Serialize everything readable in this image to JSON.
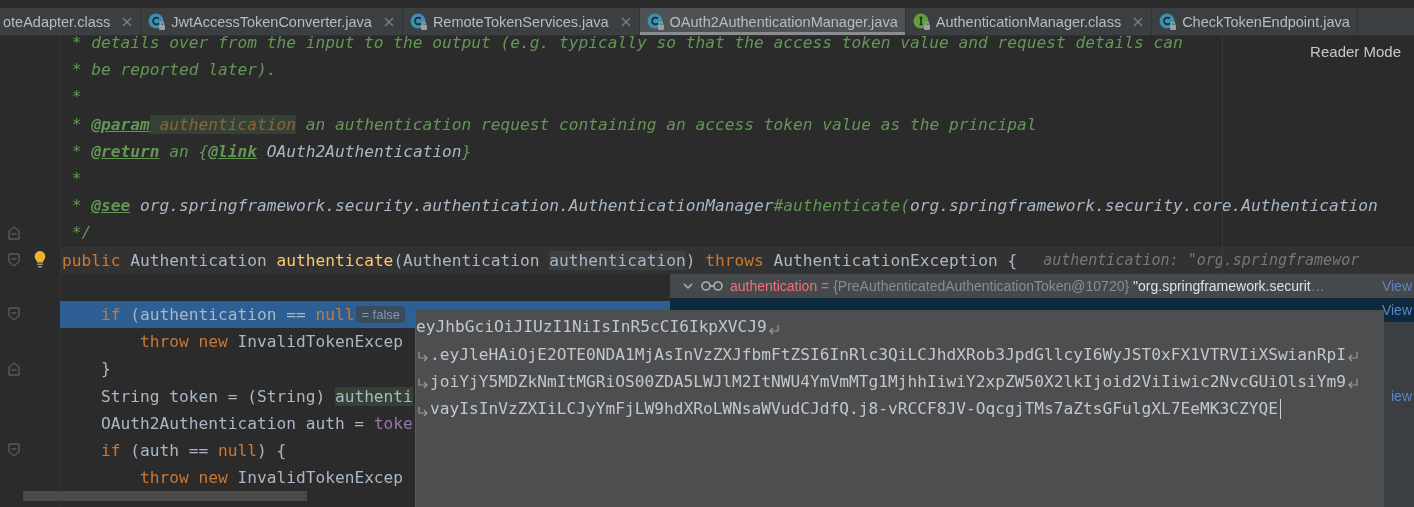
{
  "tabs": [
    {
      "label": "oteAdapter.class",
      "selected": false,
      "closable": true
    },
    {
      "label": "JwtAccessTokenConverter.java",
      "kind": "class",
      "selected": false,
      "closable": true
    },
    {
      "label": "RemoteTokenServices.java",
      "kind": "class",
      "selected": false,
      "closable": true
    },
    {
      "label": "OAuth2AuthenticationManager.java",
      "kind": "class",
      "selected": true,
      "closable": false
    },
    {
      "label": "AuthenticationManager.class",
      "kind": "interface",
      "selected": false,
      "closable": true
    },
    {
      "label": "CheckTokenEndpoint.java",
      "kind": "class",
      "selected": false,
      "closable": false
    }
  ],
  "reader_mode": "Reader Mode",
  "lines": [
    {
      "kind": "plain",
      "segments": [
        {
          "text": " * details over from the input to the output (e.g. typically so that the access token value and request details can",
          "kind": "comment"
        }
      ]
    },
    {
      "kind": "plain",
      "segments": [
        {
          "text": " * be reported later).",
          "kind": "comment"
        }
      ]
    },
    {
      "kind": "plain",
      "segments": [
        {
          "text": " *",
          "kind": "comment"
        }
      ]
    },
    {
      "kind": "plain",
      "segments": [
        {
          "text": " * ",
          "kind": "comment"
        },
        {
          "text": "@param",
          "kind": "doc-tag"
        },
        {
          "text": " authentication",
          "kind": "doc-param"
        },
        {
          "text": " an authentication request containing an access token value as the principal",
          "kind": "comment"
        }
      ]
    },
    {
      "kind": "plain",
      "segments": [
        {
          "text": " * ",
          "kind": "comment"
        },
        {
          "text": "@return",
          "kind": "doc-tag"
        },
        {
          "text": " an {",
          "kind": "comment"
        },
        {
          "text": "@link",
          "kind": "doc-tag"
        },
        {
          "text": " OAuth2Authentication",
          "kind": "doc-ref"
        },
        {
          "text": "}",
          "kind": "comment"
        }
      ]
    },
    {
      "kind": "plain",
      "segments": [
        {
          "text": " *",
          "kind": "comment"
        }
      ]
    },
    {
      "kind": "plain",
      "segments": [
        {
          "text": " * ",
          "kind": "comment"
        },
        {
          "text": "@see",
          "kind": "doc-tag"
        },
        {
          "text": " org.springframework.security.authentication.AuthenticationManager",
          "kind": "doc-ref"
        },
        {
          "text": "#authenticate(",
          "kind": "comment"
        },
        {
          "text": "org.springframework.security.core.Authentication",
          "kind": "doc-ref"
        }
      ]
    },
    {
      "kind": "plain",
      "fold_end": true,
      "segments": [
        {
          "text": " */",
          "kind": "comment"
        }
      ]
    },
    {
      "kind": "caret",
      "fold_start": true,
      "bulb": true,
      "segments": [
        {
          "text": "public",
          "kind": "keyword"
        },
        {
          "text": " Authentication ",
          "kind": "plain"
        },
        {
          "text": "authenticate",
          "kind": "method"
        },
        {
          "text": "(Authentication ",
          "kind": "plain"
        },
        {
          "text": "authentication",
          "kind": "declaration"
        },
        {
          "text": ") ",
          "kind": "plain"
        },
        {
          "text": "throws",
          "kind": "keyword"
        },
        {
          "text": " AuthenticationException {",
          "kind": "plain"
        }
      ],
      "hint": {
        "kind": "inline",
        "text": "authentication: \"org.springframewor"
      }
    },
    {
      "kind": "plain"
    },
    {
      "kind": "execution",
      "fold_start": true,
      "segments": [
        {
          "text": "    if",
          "kind": "keyword"
        },
        {
          "text": " (authentication == ",
          "kind": "plain"
        },
        {
          "text": "null",
          "kind": "keyword"
        }
      ],
      "hint": {
        "kind": "badge",
        "text": "= false"
      }
    },
    {
      "kind": "plain",
      "segments": [
        {
          "text": "        throw new",
          "kind": "keyword"
        },
        {
          "text": " InvalidTokenExcep",
          "kind": "plain"
        }
      ]
    },
    {
      "kind": "plain",
      "fold_end": true,
      "segments": [
        {
          "text": "    }",
          "kind": "plain"
        }
      ]
    },
    {
      "kind": "plain",
      "segments": [
        {
          "text": "    String token = (String) ",
          "kind": "plain"
        },
        {
          "text": "authenti",
          "kind": "usage"
        }
      ]
    },
    {
      "kind": "plain",
      "segments": [
        {
          "text": "    OAuth2Authentication auth = ",
          "kind": "plain"
        },
        {
          "text": "toke",
          "kind": "field"
        }
      ]
    },
    {
      "kind": "plain",
      "fold_start": true,
      "segments": [
        {
          "text": "    if",
          "kind": "keyword"
        },
        {
          "text": " (auth == ",
          "kind": "plain"
        },
        {
          "text": "null",
          "kind": "keyword"
        },
        {
          "text": ") {",
          "kind": "plain"
        }
      ]
    },
    {
      "kind": "plain",
      "segments": [
        {
          "text": "        throw new",
          "kind": "keyword"
        },
        {
          "text": " InvalidTokenExcep",
          "kind": "plain"
        }
      ]
    }
  ],
  "debugger": {
    "rows": [
      {
        "kind": "object",
        "expanded": true,
        "selected": false,
        "name": "authentication",
        "equals": "=",
        "type": "{PreAuthenticatedAuthenticationToken@10720}",
        "value": "\"org.springframework.securit",
        "more": "…",
        "link": "View"
      },
      {
        "kind": "field",
        "selected": true,
        "link": "View"
      },
      {
        "kind": "fragment",
        "selected": false,
        "link": "iew"
      }
    ]
  },
  "value_popup": {
    "lines": [
      {
        "text": "eyJhbGciOiJIUzI1NiIsInR5cCI6IkpXVCJ9",
        "continued": false,
        "wraps": true,
        "cursor": false
      },
      {
        "text": ".eyJleHAiOjE2OTE0NDA1MjAsInVzZXJfbmFtZSI6InRlc3QiLCJhdXRob3JpdGllcyI6WyJST0xFX1VTRVIiXSwianRpI",
        "continued": true,
        "wraps": true,
        "cursor": false
      },
      {
        "text": "joiYjY5MDZkNmItMGRiOS00ZDA5LWJlM2ItNWU4YmVmMTg1MjhhIiwiY2xpZW50X2lkIjoid2ViIiwic2NvcGUiOlsiYm9",
        "continued": true,
        "wraps": true,
        "cursor": false
      },
      {
        "text": "vayIsInVzZXIiLCJyYmFjLW9hdXRoLWNsaWVudCJdfQ.j8-vRCCF8JV-OqcgjTMs7aZtsGFulgXL7EeMK3CZYQE",
        "continued": true,
        "wraps": false,
        "cursor": true
      }
    ]
  }
}
